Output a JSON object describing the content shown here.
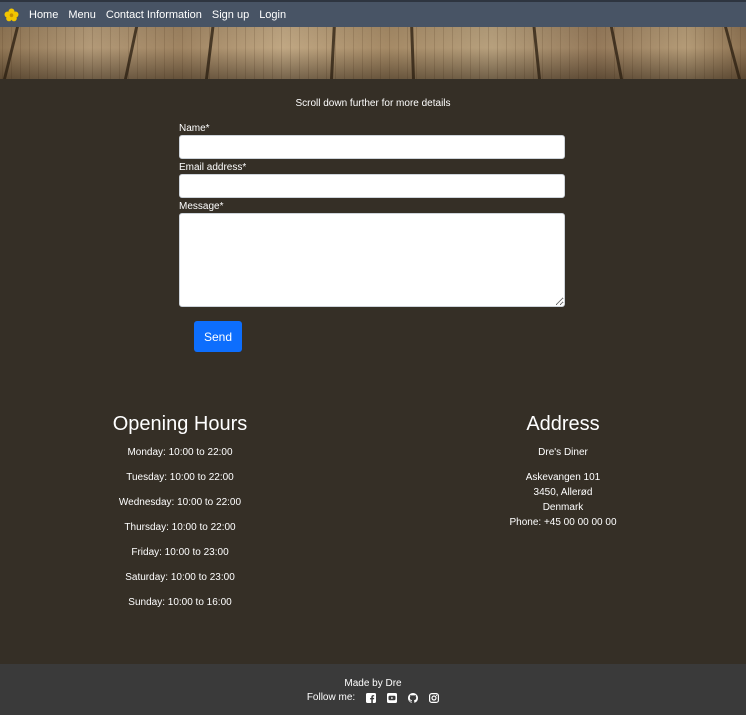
{
  "nav": {
    "logo_icon": "yellow-flower-icon",
    "links": [
      "Home",
      "Menu",
      "Contact Information",
      "Sign up",
      "Login"
    ]
  },
  "intro_text": "Scroll down further for more details",
  "form": {
    "name_label": "Name*",
    "email_label": "Email address*",
    "message_label": "Message*",
    "name_value": "",
    "email_value": "",
    "message_value": "",
    "send_label": "Send"
  },
  "hours": {
    "title": "Opening Hours",
    "items": [
      "Monday: 10:00 to 22:00",
      "Tuesday: 10:00 to 22:00",
      "Wednesday: 10:00 to 22:00",
      "Thursday: 10:00 to 22:00",
      "Friday: 10:00 to 23:00",
      "Saturday: 10:00 to 23:00",
      "Sunday: 10:00 to 16:00"
    ]
  },
  "address": {
    "title": "Address",
    "name": "Dre's Diner",
    "street": "Askevangen 101",
    "city": "3450, Allerød",
    "country": "Denmark",
    "phone": "Phone: +45 00 00 00 00"
  },
  "footer": {
    "made_by": "Made by Dre",
    "follow_label": "Follow me:",
    "social_icons": [
      "facebook-icon",
      "youtube-icon",
      "github-icon",
      "instagram-icon"
    ]
  },
  "colors": {
    "navbar": "#485465",
    "body": "#352f26",
    "footer": "#3a3a3a",
    "button": "#0d6efd",
    "logo": "#f2c500"
  }
}
